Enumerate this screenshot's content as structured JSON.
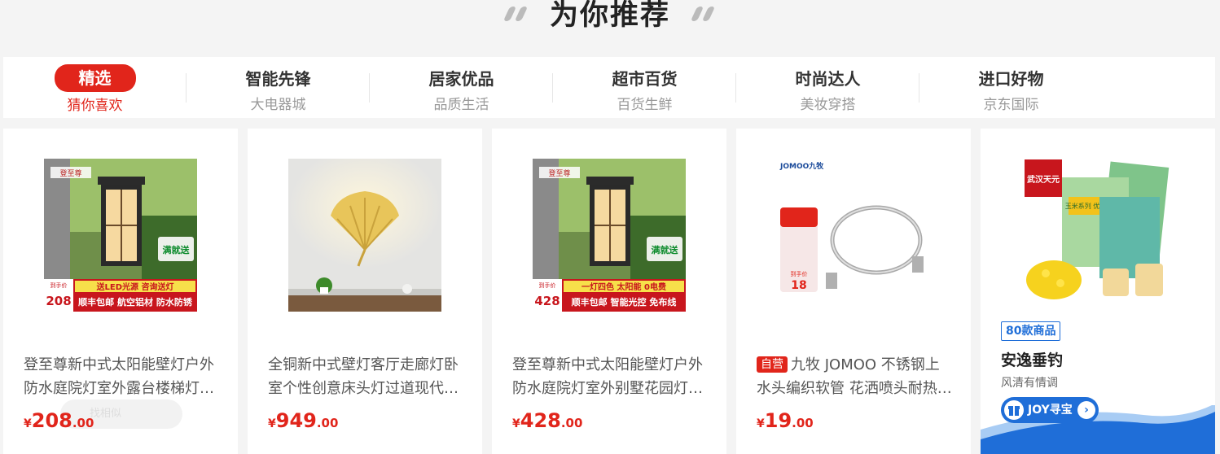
{
  "header": {
    "title": "为你推荐"
  },
  "tabs": [
    {
      "label": "精选",
      "sub": "猜你喜欢"
    },
    {
      "label": "智能先锋",
      "sub": "大电器城"
    },
    {
      "label": "居家优品",
      "sub": "品质生活"
    },
    {
      "label": "超市百货",
      "sub": "百货生鲜"
    },
    {
      "label": "时尚达人",
      "sub": "美妆穿搭"
    },
    {
      "label": "进口好物",
      "sub": "京东国际"
    }
  ],
  "products": [
    {
      "title": "登至尊新中式太阳能壁灯户外防水庭院灯室外露台楼梯灯…",
      "currency": "¥",
      "price_int": "208",
      "price_dec": ".00",
      "image_text": {
        "logo": "登至尊",
        "promo": "满就送",
        "line1": "送LED光源 咨询送灯",
        "line2": "顺丰包邮 航空铝材 防水防锈",
        "price_label": "到手价",
        "price": "208"
      }
    },
    {
      "title": "全铜新中式壁灯客厅走廊灯卧室个性创意床头灯过道现代…",
      "currency": "¥",
      "price_int": "949",
      "price_dec": ".00"
    },
    {
      "title": "登至尊新中式太阳能壁灯户外防水庭院灯室外别墅花园灯…",
      "currency": "¥",
      "price_int": "428",
      "price_dec": ".00",
      "image_text": {
        "logo": "登至尊",
        "promo": "满就送",
        "line1": "一灯四色 太阳能 0电费",
        "line2": "顺丰包邮 智能光控 免布线",
        "price_label": "到手价",
        "price": "428"
      }
    },
    {
      "title": "九牧 JOMOO 不锈钢上水头编织软管 花洒喷头耐热…",
      "self_tag": "自营",
      "currency": "¥",
      "price_int": "19",
      "price_dec": ".00",
      "image_text": {
        "brand": "JOMOO九牧",
        "price_label": "到手价",
        "price": "18"
      }
    }
  ],
  "ghost_button": {
    "label": "找相似"
  },
  "shop": {
    "badge": "80款商品",
    "name": "安逸垂钓",
    "desc": "风清有情调",
    "button": "JOY寻宝",
    "image_text": {
      "brand": "武汉天元",
      "pack": "玉米系列 优选颗玉米"
    }
  },
  "colors": {
    "accent": "#e1251b",
    "blue": "#1f6ed8"
  }
}
